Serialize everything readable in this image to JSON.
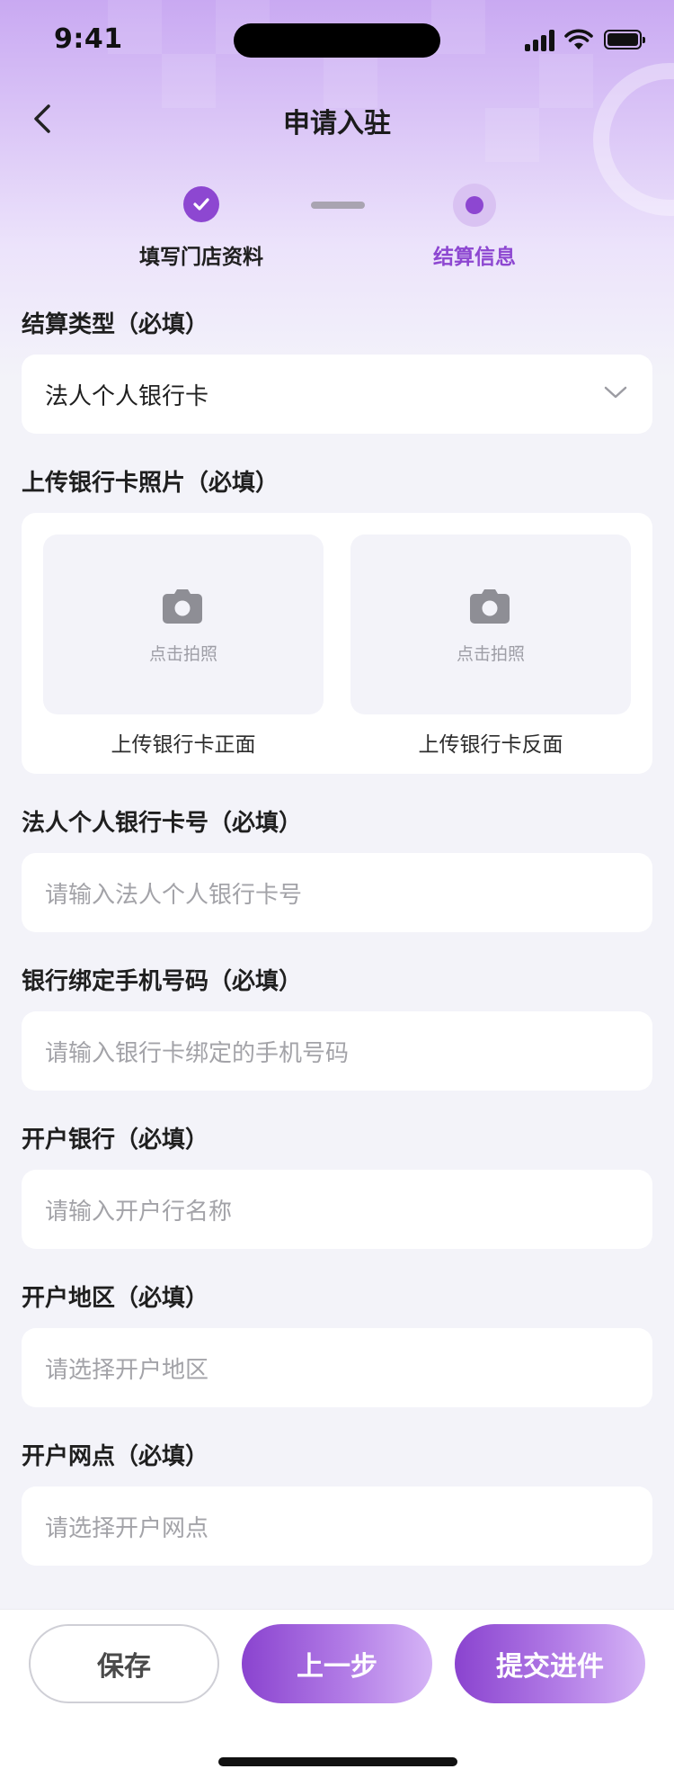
{
  "status_bar": {
    "time": "9:41"
  },
  "nav": {
    "title": "申请入驻"
  },
  "steps": [
    {
      "label": "填写门店资料",
      "state": "done"
    },
    {
      "label": "结算信息",
      "state": "active"
    }
  ],
  "settlement_type": {
    "label": "结算类型（必填）",
    "value": "法人个人银行卡"
  },
  "bank_card_photo": {
    "label": "上传银行卡照片（必填）",
    "front": {
      "tap_text": "点击拍照",
      "caption": "上传银行卡正面"
    },
    "back": {
      "tap_text": "点击拍照",
      "caption": "上传银行卡反面"
    }
  },
  "card_number": {
    "label": "法人个人银行卡号（必填）",
    "placeholder": "请输入法人个人银行卡号"
  },
  "bound_phone": {
    "label": "银行绑定手机号码（必填）",
    "placeholder": "请输入银行卡绑定的手机号码"
  },
  "bank_name": {
    "label": "开户银行（必填）",
    "placeholder": "请输入开户行名称"
  },
  "bank_region": {
    "label": "开户地区（必填）",
    "placeholder": "请选择开户地区"
  },
  "bank_branch": {
    "label": "开户网点（必填）",
    "placeholder": "请选择开户网点"
  },
  "actions": {
    "save": "保存",
    "prev": "上一步",
    "submit": "提交进件"
  },
  "colors": {
    "accent": "#8d47d1",
    "accent_light": "#d9c2f2",
    "background": "#f3f3f9"
  }
}
